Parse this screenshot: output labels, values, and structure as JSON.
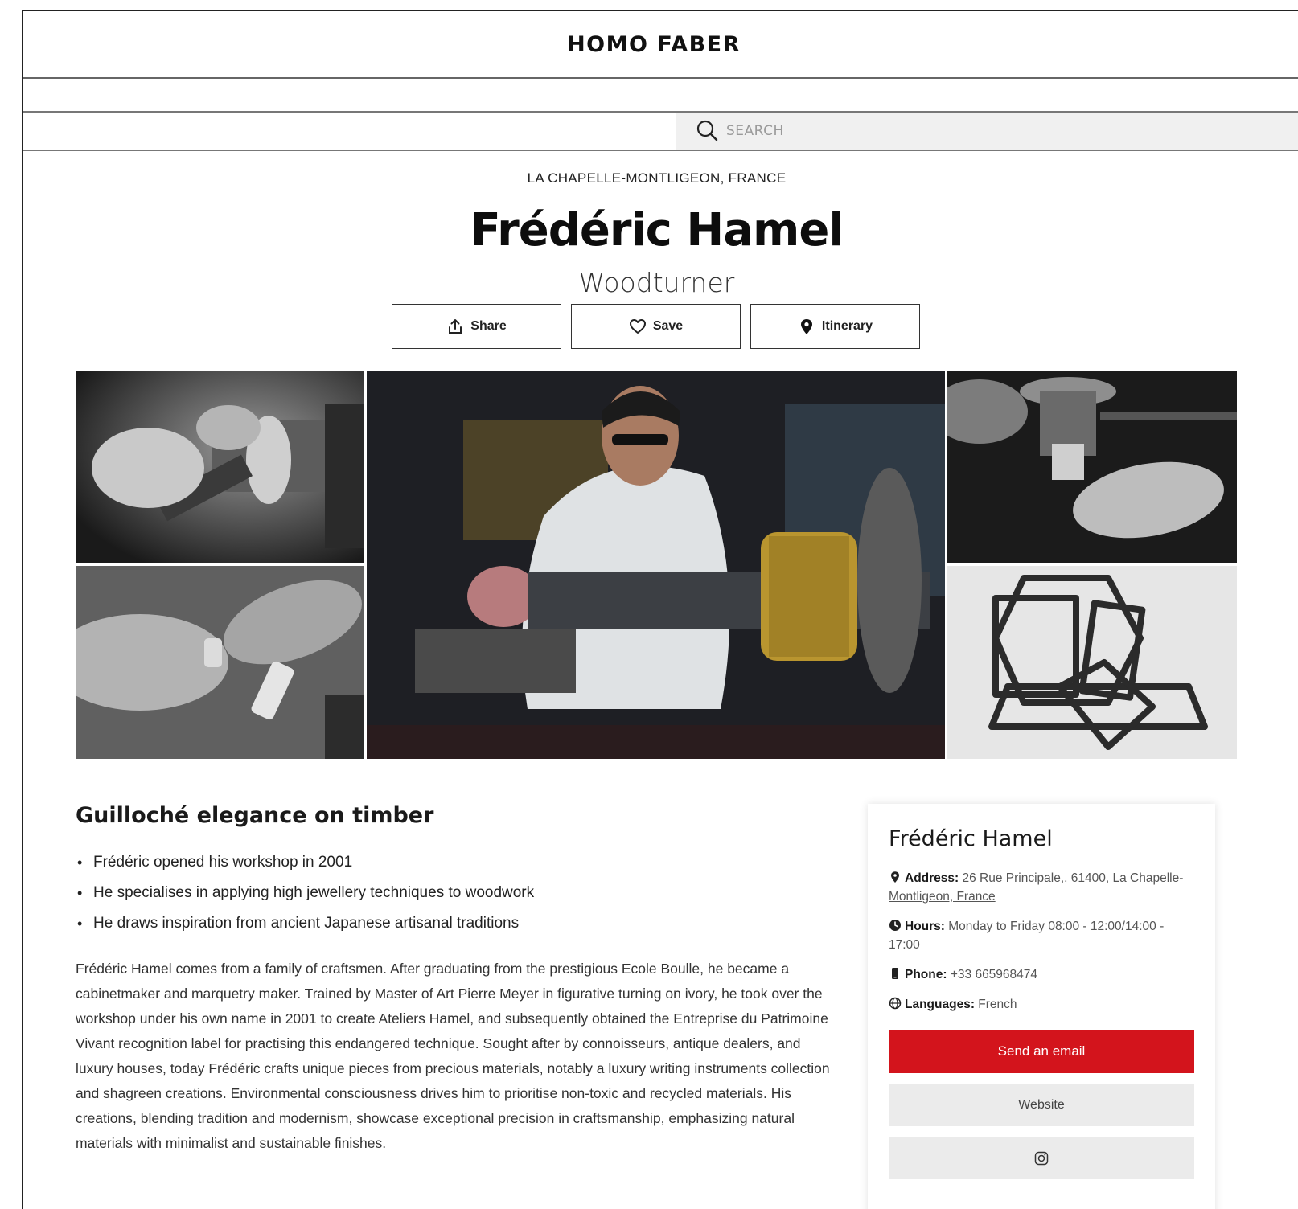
{
  "site": {
    "brand": "HOMO FABER"
  },
  "search": {
    "placeholder": "SEARCH"
  },
  "artisan": {
    "location": "LA CHAPELLE-MONTLIGEON, FRANCE",
    "name": "Frédéric Hamel",
    "profession": "Woodturner"
  },
  "actions": {
    "share": "Share",
    "save": "Save",
    "itinerary": "Itinerary"
  },
  "gallery": {
    "photos": [
      "hands-on-lathe-photo",
      "hands-holding-cylinders-photo",
      "artisan-at-lathe-photo",
      "lathe-detail-photo",
      "hexagon-frames-photo"
    ]
  },
  "about": {
    "tagline": "Guilloché elegance on timber",
    "highlights": [
      "Frédéric opened his workshop in 2001",
      "He specialises in applying high jewellery techniques to woodwork",
      "He draws inspiration from ancient Japanese artisanal traditions"
    ],
    "bio": "Frédéric Hamel comes from a family of craftsmen. After graduating from the prestigious Ecole Boulle, he became a cabinetmaker and marquetry maker. Trained by Master of Art Pierre Meyer in figurative turning on ivory, he took over the workshop under his own name in 2001 to create Ateliers Hamel, and subsequently obtained the Entreprise du Patrimoine Vivant recognition label for practising this endangered technique. Sought after by connoisseurs, antique dealers, and luxury houses, today Frédéric crafts unique pieces from precious materials, notably a luxury writing instruments collection and shagreen creations. Environmental consciousness drives him to prioritise non-toxic and recycled materials. His creations, blending tradition and modernism, showcase exceptional precision in craftsmanship, emphasizing natural materials with minimalist and sustainable finishes."
  },
  "contact": {
    "title": "Frédéric Hamel",
    "address_label": "Address:",
    "address_value": "26 Rue Principale,, 61400, La Chapelle-Montligeon, France",
    "hours_label": "Hours:",
    "hours_value": "Monday to Friday 08:00 - 12:00/14:00 - 17:00",
    "phone_label": "Phone:",
    "phone_value": "+33 665968474",
    "languages_label": "Languages:",
    "languages_value": "French",
    "email_button": "Send an email",
    "website_button": "Website",
    "instagram_icon": "instagram-icon"
  },
  "colors": {
    "accent_red": "#d3141c",
    "button_grey": "#ebebeb",
    "search_bg": "#f0f0f0"
  }
}
